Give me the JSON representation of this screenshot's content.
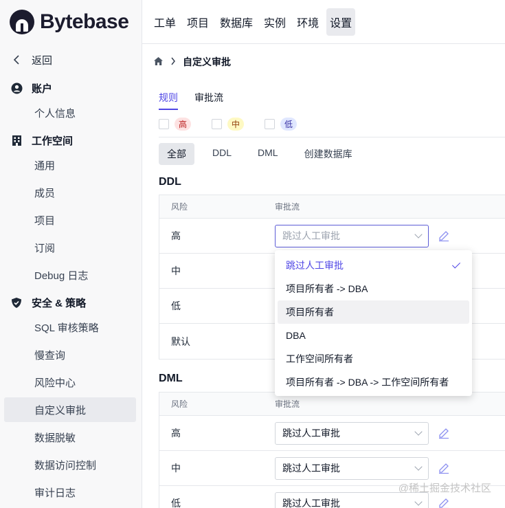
{
  "brand": {
    "name": "Bytebase"
  },
  "sidebar": {
    "back_label": "返回",
    "sections": [
      {
        "title": "账户",
        "icon": "user-circle-icon",
        "items": [
          {
            "label": "个人信息"
          }
        ]
      },
      {
        "title": "工作空间",
        "icon": "building-icon",
        "items": [
          {
            "label": "通用"
          },
          {
            "label": "成员"
          },
          {
            "label": "项目"
          },
          {
            "label": "订阅"
          },
          {
            "label": "Debug 日志"
          }
        ]
      },
      {
        "title": "安全 & 策略",
        "icon": "shield-icon",
        "items": [
          {
            "label": "SQL 审核策略"
          },
          {
            "label": "慢查询"
          },
          {
            "label": "风险中心"
          },
          {
            "label": "自定义审批",
            "active": true
          },
          {
            "label": "数据脱敏"
          },
          {
            "label": "数据访问控制"
          },
          {
            "label": "审计日志"
          }
        ]
      }
    ]
  },
  "topnav": {
    "items": [
      "工单",
      "项目",
      "数据库",
      "实例",
      "环境",
      "设置"
    ],
    "active": "设置"
  },
  "breadcrumb": {
    "current": "自定义审批"
  },
  "tabs": {
    "items": [
      "规则",
      "审批流"
    ],
    "active": "规则"
  },
  "risk_filters": [
    "高",
    "中",
    "低"
  ],
  "segments": {
    "items": [
      "全部",
      "DDL",
      "DML",
      "创建数据库"
    ],
    "active": "全部"
  },
  "ddl": {
    "title": "DDL",
    "headers": [
      "风险",
      "审批流"
    ],
    "rows": [
      {
        "risk": "高",
        "flow": "跳过人工审批"
      },
      {
        "risk": "中",
        "flow": ""
      },
      {
        "risk": "低",
        "flow": ""
      },
      {
        "risk": "默认",
        "flow": ""
      }
    ]
  },
  "dml": {
    "title": "DML",
    "headers": [
      "风险",
      "审批流"
    ],
    "rows": [
      {
        "risk": "高",
        "flow": "跳过人工审批"
      },
      {
        "risk": "中",
        "flow": "跳过人工审批"
      },
      {
        "risk": "低",
        "flow": "跳过人工审批"
      }
    ]
  },
  "dropdown": {
    "options": [
      "跳过人工审批",
      "项目所有者 -> DBA",
      "项目所有者",
      "DBA",
      "工作空间所有者",
      "项目所有者 -> DBA -> 工作空间所有者"
    ],
    "selected": "跳过人工审批",
    "hovered": "项目所有者"
  },
  "watermark": "@稀土掘金技术社区",
  "colors": {
    "accent": "#4f46e5",
    "high": "#b91c1c",
    "mid": "#92400e",
    "low": "#3730a3"
  }
}
